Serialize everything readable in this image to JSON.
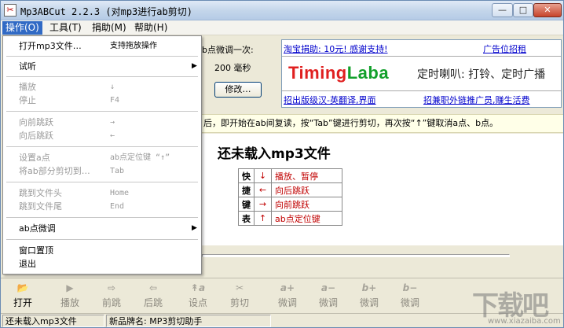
{
  "window": {
    "title": "Mp3ABCut 2.2.3 (对mp3进行ab剪切)",
    "min_glyph": "—",
    "max_glyph": "□",
    "close_glyph": "✕"
  },
  "menubar": [
    {
      "label": "操作(O)"
    },
    {
      "label": "工具(T)"
    },
    {
      "label": "捐助(M)"
    },
    {
      "label": "帮助(H)"
    }
  ],
  "dropdown": {
    "items": [
      {
        "label": "打开mp3文件…",
        "shortcut": "支持拖放操作",
        "disabled": false,
        "arrow": ""
      },
      {
        "label": "试听",
        "shortcut": "",
        "disabled": false,
        "arrow": "▶"
      },
      {
        "label": "播放",
        "shortcut": "↓",
        "disabled": true,
        "arrow": ""
      },
      {
        "label": "停止",
        "shortcut": "F4",
        "disabled": true,
        "arrow": ""
      },
      {
        "label": "向前跳跃",
        "shortcut": "→",
        "disabled": true,
        "arrow": ""
      },
      {
        "label": "向后跳跃",
        "shortcut": "←",
        "disabled": true,
        "arrow": ""
      },
      {
        "label": "设置a点",
        "shortcut": "ab点定位键 “↑”",
        "disabled": true,
        "arrow": ""
      },
      {
        "label": "将ab部分剪切到…",
        "shortcut": "Tab",
        "disabled": true,
        "arrow": ""
      },
      {
        "label": "跳到文件头",
        "shortcut": "Home",
        "disabled": true,
        "arrow": ""
      },
      {
        "label": "跳到文件尾",
        "shortcut": "End",
        "disabled": true,
        "arrow": ""
      },
      {
        "label": "ab点微调",
        "shortcut": "",
        "disabled": false,
        "arrow": "▶"
      },
      {
        "label": "窗口置顶",
        "shortcut": "",
        "disabled": false,
        "arrow": ""
      },
      {
        "label": "退出",
        "shortcut": "",
        "disabled": false,
        "arrow": ""
      }
    ]
  },
  "settings": {
    "label": "b点微调一次:",
    "value": "200 毫秒",
    "modify_button": "修改…"
  },
  "ad": {
    "top_left_link": "淘宝捐助: 10元! 感谢支持!",
    "top_right_link": "广告位招租",
    "brand_part1": "Timing",
    "brand_part2": "Laba",
    "slogan": "定时喇叭: 打铃、定时广播",
    "bottom_left_link": "招出版级汉-英翻译,界面",
    "bottom_right_link": "招兼职外链推广员,赚生活费"
  },
  "hint": "后，即开始在ab间复读，按“Tab”键进行剪切，再次按“↑”键取消a点、b点。",
  "main": {
    "status": "还未载入mp3文件",
    "shortcut_table": [
      {
        "key": "快",
        "arrow": "↓",
        "desc": "播放、暂停"
      },
      {
        "key": "捷",
        "arrow": "←",
        "desc": "向后跳跃"
      },
      {
        "key": "键",
        "arrow": "→",
        "desc": "向前跳跃"
      },
      {
        "key": "表",
        "arrow": "↑",
        "desc": "ab点定位键"
      }
    ]
  },
  "toolbar": [
    {
      "label": "打开",
      "icon": "folder-open-icon",
      "glyph": "📂",
      "enabled": true
    },
    {
      "label": "播放",
      "icon": "play-icon",
      "glyph": "▶",
      "enabled": false
    },
    {
      "label": "前跳",
      "icon": "forward-icon",
      "glyph": "⇨",
      "enabled": false
    },
    {
      "label": "后跳",
      "icon": "backward-icon",
      "glyph": "⇦",
      "enabled": false
    },
    {
      "label": "设点",
      "icon": "set-point-icon",
      "glyph": "↟a",
      "enabled": false
    },
    {
      "label": "剪切",
      "icon": "scissors-icon",
      "glyph": "✂",
      "enabled": false
    },
    {
      "label": "微调",
      "icon": "a-plus-icon",
      "glyph": "a+",
      "enabled": false
    },
    {
      "label": "微调",
      "icon": "a-minus-icon",
      "glyph": "a−",
      "enabled": false
    },
    {
      "label": "微调",
      "icon": "b-plus-icon",
      "glyph": "b+",
      "enabled": false
    },
    {
      "label": "微调",
      "icon": "b-minus-icon",
      "glyph": "b−",
      "enabled": false
    }
  ],
  "statusbar": {
    "left": "还未载入mp3文件",
    "right": "新品牌名: MP3剪切助手"
  },
  "watermark": {
    "text": "下载吧",
    "sub": "www.xiazaiba.com"
  },
  "colors": {
    "menu_highlight": "#316ac5",
    "link": "#0000cc",
    "shortcut_red": "#c00000",
    "brand_red": "#e02020",
    "brand_green": "#12a02b"
  }
}
